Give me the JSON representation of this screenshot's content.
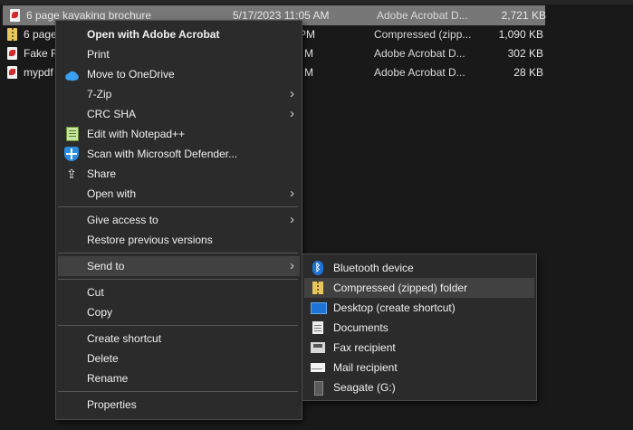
{
  "files": [
    {
      "name": "6 page kayaking brochure",
      "date": "5/17/2023 11:05 AM",
      "type": "Adobe Acrobat D...",
      "size": "2,721 KB",
      "icon": "pdf-icon",
      "selected": true
    },
    {
      "name": "6 page",
      "date": "PM",
      "type": "Compressed (zipp...",
      "size": "1,090 KB",
      "icon": "zip-icon",
      "selected": false
    },
    {
      "name": "Fake F",
      "date": "M",
      "type": "Adobe Acrobat D...",
      "size": "302 KB",
      "icon": "pdf-icon",
      "selected": false
    },
    {
      "name": "mypdf",
      "date": "M",
      "type": "Adobe Acrobat D...",
      "size": "28 KB",
      "icon": "pdf-icon",
      "selected": false
    }
  ],
  "context_menu": {
    "open_with_acrobat": "Open with Adobe Acrobat",
    "print": "Print",
    "move_to_onedrive": "Move to OneDrive",
    "seven_zip": "7-Zip",
    "crc_sha": "CRC SHA",
    "edit_notepad": "Edit with Notepad++",
    "scan_defender": "Scan with Microsoft Defender...",
    "share": "Share",
    "open_with": "Open with",
    "give_access": "Give access to",
    "restore_versions": "Restore previous versions",
    "send_to": "Send to",
    "cut": "Cut",
    "copy": "Copy",
    "create_shortcut": "Create shortcut",
    "delete": "Delete",
    "rename": "Rename",
    "properties": "Properties"
  },
  "send_to_menu": {
    "bluetooth": "Bluetooth device",
    "compressed": "Compressed (zipped) folder",
    "desktop": "Desktop (create shortcut)",
    "documents": "Documents",
    "fax": "Fax recipient",
    "mail": "Mail recipient",
    "seagate": "Seagate (G:)"
  },
  "colors": {
    "background": "#191919",
    "menu_bg": "#2b2b2b",
    "highlight": "#414141",
    "selected_row": "#777777"
  }
}
